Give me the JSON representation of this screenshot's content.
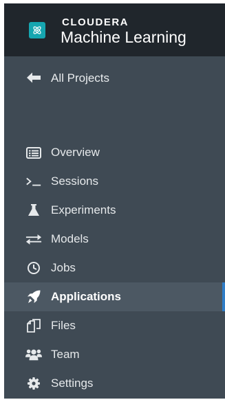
{
  "brand": {
    "company": "CLOUDERA",
    "product": "Machine Learning",
    "logo_icon": "atom-icon",
    "logo_color": "#16a6b0"
  },
  "back_link": {
    "label": "All Projects",
    "icon": "arrow-left-icon"
  },
  "nav": {
    "active_item": "Applications",
    "active_indicator_color": "#2f7dc7",
    "items": [
      {
        "label": "Overview",
        "icon": "list-icon"
      },
      {
        "label": "Sessions",
        "icon": "terminal-icon"
      },
      {
        "label": "Experiments",
        "icon": "flask-icon"
      },
      {
        "label": "Models",
        "icon": "arrows-exchange-icon"
      },
      {
        "label": "Jobs",
        "icon": "clock-icon"
      },
      {
        "label": "Applications",
        "icon": "rocket-icon"
      },
      {
        "label": "Files",
        "icon": "files-icon"
      },
      {
        "label": "Team",
        "icon": "users-icon"
      },
      {
        "label": "Settings",
        "icon": "gear-icon"
      }
    ]
  }
}
